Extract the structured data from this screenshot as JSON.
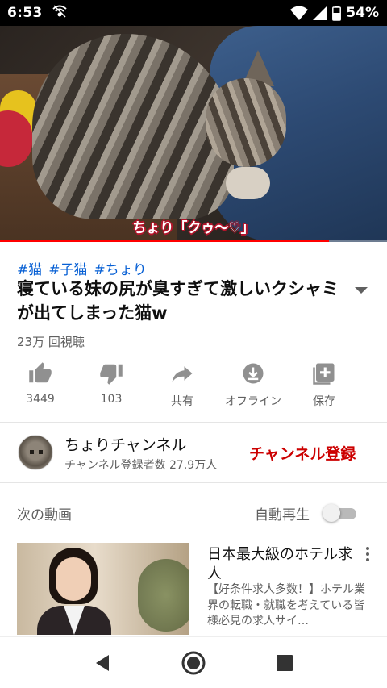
{
  "status_bar": {
    "time": "6:53",
    "battery": "54%",
    "icons": [
      "vpn-icon",
      "wifi-icon",
      "signal-icon",
      "battery-icon"
    ]
  },
  "video": {
    "caption": "ちょり「クゥ〜♡」",
    "progress_fraction": 0.85
  },
  "info": {
    "hashtags": [
      "#猫",
      "#子猫",
      "#ちょり"
    ],
    "title": "寝ている妹の尻が臭すぎて激しいクシャミが出てしまった猫w",
    "views": "23万 回視聴"
  },
  "actions": [
    {
      "name": "like",
      "icon": "thumbs-up-icon",
      "label": "3449"
    },
    {
      "name": "dislike",
      "icon": "thumbs-down-icon",
      "label": "103"
    },
    {
      "name": "share",
      "icon": "share-icon",
      "label": "共有"
    },
    {
      "name": "offline",
      "icon": "download-icon",
      "label": "オフライン"
    },
    {
      "name": "save",
      "icon": "playlist-add-icon",
      "label": "保存"
    }
  ],
  "channel": {
    "name": "ちょりチャンネル",
    "subscribers": "チャンネル登録者数 27.9万人",
    "subscribe_label": "チャンネル登録"
  },
  "up_next": {
    "label": "次の動画",
    "autoplay_label": "自動再生",
    "autoplay_on": false
  },
  "recommendation": {
    "title": "日本最大級のホテル求人",
    "description": "【好条件求人多数！】ホテル業界の転職・就職を考えている皆様必見の求人サイ…"
  },
  "colors": {
    "accent_red": "#cc0000",
    "link_blue": "#065fd4",
    "icon_gray": "#909090"
  }
}
